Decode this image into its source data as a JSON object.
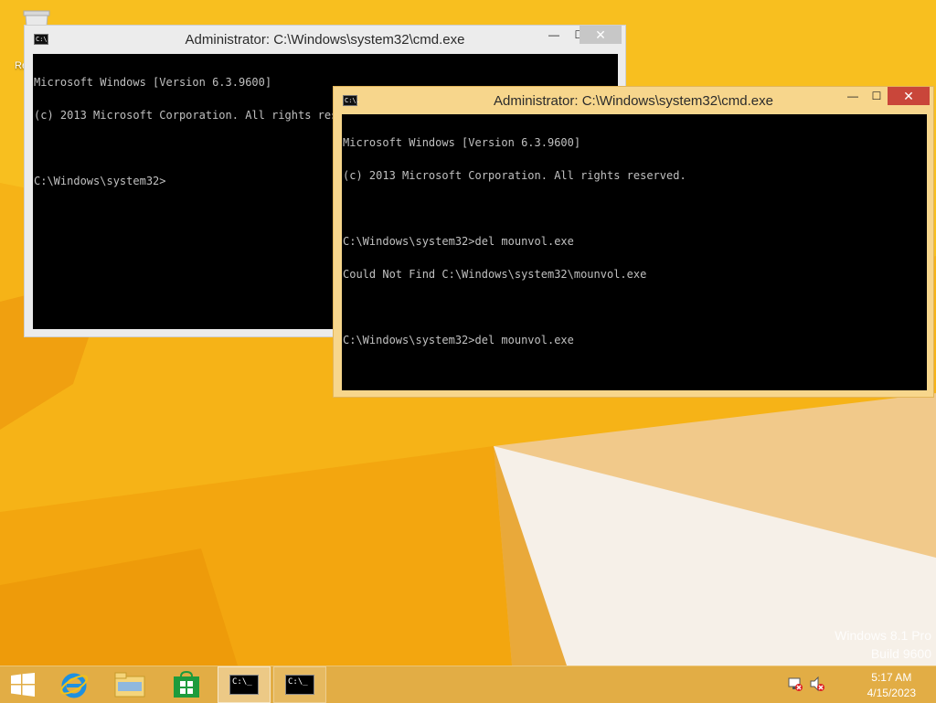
{
  "desktop": {
    "recycle_bin_label": "Recycle Bin"
  },
  "windows": [
    {
      "id": "cmd-back",
      "title": "Administrator: C:\\Windows\\system32\\cmd.exe",
      "icon": "cmd-icon",
      "icon_text": "C:\\.",
      "console_lines": [
        "Microsoft Windows [Version 6.3.9600]",
        "(c) 2013 Microsoft Corporation. All rights reserved.",
        "",
        "C:\\Windows\\system32>"
      ]
    },
    {
      "id": "cmd-front",
      "title": "Administrator: C:\\Windows\\system32\\cmd.exe",
      "icon": "cmd-icon",
      "icon_text": "C:\\.",
      "console_lines": [
        "Microsoft Windows [Version 6.3.9600]",
        "(c) 2013 Microsoft Corporation. All rights reserved.",
        "",
        "C:\\Windows\\system32>del mounvol.exe",
        "Could Not Find C:\\Windows\\system32\\mounvol.exe",
        "",
        "C:\\Windows\\system32>del mounvol.exe"
      ]
    }
  ],
  "title_buttons": {
    "minimize": "—",
    "maximize": "☐",
    "close": "✕"
  },
  "watermark": {
    "line1": "Windows 8.1 Pro",
    "line2": "Build 9600"
  },
  "taskbar": {
    "items": [
      {
        "name": "start-button",
        "icon": "windows-logo-icon"
      },
      {
        "name": "internet-explorer-button",
        "icon": "internet-explorer-icon"
      },
      {
        "name": "file-explorer-button",
        "icon": "file-explorer-icon"
      },
      {
        "name": "store-button",
        "icon": "store-icon"
      },
      {
        "name": "cmd-taskbar-button-1",
        "icon": "cmd-icon",
        "icon_text": "C:\\_"
      },
      {
        "name": "cmd-taskbar-button-2",
        "icon": "cmd-icon",
        "icon_text": "C:\\_"
      }
    ],
    "tray": {
      "network_icon": "network-disconnected-icon",
      "volume_icon": "volume-muted-icon",
      "time": "5:17 AM",
      "date": "4/15/2023"
    }
  },
  "colors": {
    "wallpaper": "#f6b317",
    "active_title": "#f7d68c",
    "close_active": "#c9463a",
    "console_bg": "#000000",
    "console_fg": "#c0c0c0"
  }
}
